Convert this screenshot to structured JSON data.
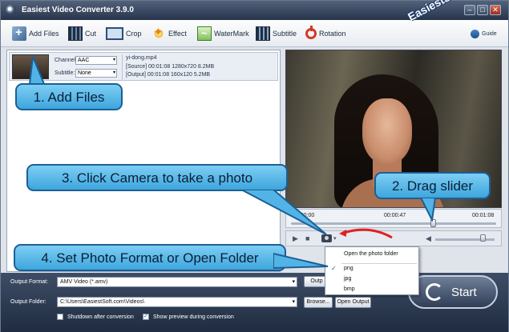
{
  "window": {
    "title": "Easiest Video Converter 3.9.0",
    "controls": {
      "minimize": "–",
      "maximize": "□",
      "close": "✕"
    }
  },
  "brand": "EasiestSoft.com",
  "toolbar": {
    "add_files": "Add Files",
    "cut": "Cut",
    "crop": "Crop",
    "effect": "Effect",
    "watermark": "WaterMark",
    "subtitle": "Subtitle",
    "rotation": "Rotation",
    "guide": "Guide"
  },
  "file": {
    "channel_label": "Channel:",
    "channel_value": "AAC",
    "subtitle_label": "Subtitle:",
    "subtitle_value": "None",
    "name": "yi-dong.mp4",
    "source": "[Source]  00:01:08  1280x720  8.2MB",
    "output": "[Output]  00:01:08  160x120  5.2MB"
  },
  "player": {
    "time_start": "00:00:00",
    "time_current": "00:00:47",
    "time_end": "00:01:08",
    "position": 0.69,
    "volume": 0.8
  },
  "photo_menu": {
    "open_folder": "Open the photo folder",
    "formats": [
      "png",
      "jpg",
      "bmp"
    ],
    "selected": "png"
  },
  "bottom": {
    "output_format_label": "Output Format:",
    "output_format_value": "AMV Video (*.amv)",
    "output_folder_label": "Output Folder:",
    "output_folder_value": "C:\\Users\\EasiestSoft.com\\Videos\\",
    "browse": "Browse...",
    "open_output": "Open Output",
    "output_btn_partial": "Outp",
    "shutdown": "Shutdown after conversion",
    "show_preview": "Show preview during conversion",
    "start": "Start"
  },
  "callouts": {
    "step1": "1. Add Files",
    "step2": "2. Drag slider",
    "step3": "3. Click Camera to take a photo",
    "step4": "4. Set Photo Format or Open Folder"
  },
  "colors": {
    "callout_fill": "#52b4e6",
    "callout_border": "#1c5f96",
    "arrow": "#e02020",
    "check": "#1a5fb4"
  }
}
